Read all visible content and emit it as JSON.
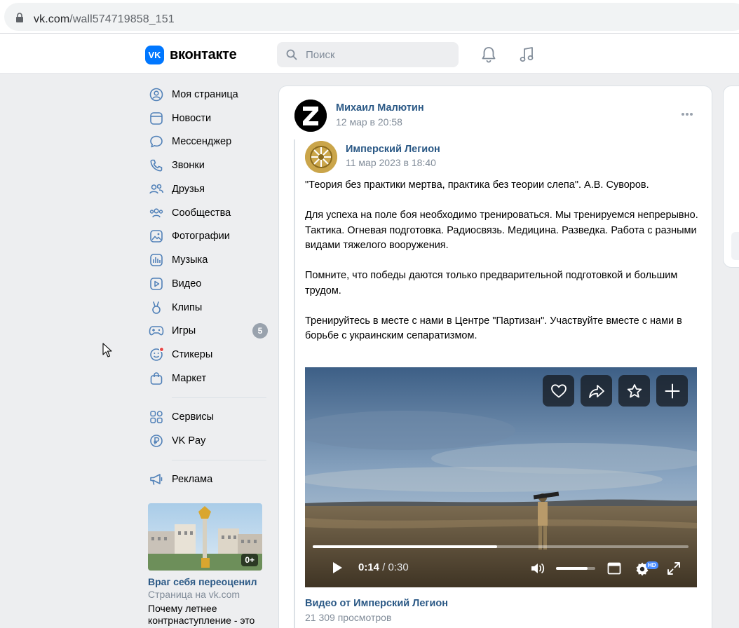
{
  "browser": {
    "url_host": "vk.com",
    "url_path": "/wall574719858_151"
  },
  "header": {
    "logo_text": "вконтакте",
    "logo_mark": "VK",
    "search_placeholder": "Поиск",
    "icons": [
      "bell-icon",
      "music-note-icon"
    ]
  },
  "sidebar": {
    "items": [
      {
        "label": "Моя страница",
        "icon": "user-circle-icon"
      },
      {
        "label": "Новости",
        "icon": "news-icon"
      },
      {
        "label": "Мессенджер",
        "icon": "message-icon"
      },
      {
        "label": "Звонки",
        "icon": "phone-icon"
      },
      {
        "label": "Друзья",
        "icon": "friends-icon"
      },
      {
        "label": "Сообщества",
        "icon": "communities-icon"
      },
      {
        "label": "Фотографии",
        "icon": "photo-icon"
      },
      {
        "label": "Музыка",
        "icon": "music-bars-icon"
      },
      {
        "label": "Видео",
        "icon": "video-icon"
      },
      {
        "label": "Клипы",
        "icon": "clips-icon"
      },
      {
        "label": "Игры",
        "icon": "gamepad-icon",
        "badge": "5"
      },
      {
        "label": "Стикеры",
        "icon": "sticker-icon"
      },
      {
        "label": "Маркет",
        "icon": "market-bag-icon"
      },
      {
        "label": "Сервисы",
        "icon": "services-grid-icon"
      },
      {
        "label": "VK Pay",
        "icon": "ruble-icon"
      },
      {
        "label": "Реклама",
        "icon": "megaphone-icon"
      }
    ],
    "promo": {
      "age": "0+",
      "title": "Враг себя переоценил",
      "subtitle": "Страница на vk.com",
      "text": "Почему летнее контрнаступление - это"
    }
  },
  "post": {
    "author": "Михаил Малютин",
    "date": "12 мар в 20:58",
    "avatar_letter": "Z",
    "repost": {
      "author": "Имперский Легион",
      "date": "11 мар 2023 в 18:40",
      "text": "\"Теория без практики мертва, практика без теории слепа\". А.В. Суворов.\n\nДля успеха на поле боя необходимо тренироваться. Мы тренируемся непрерывно.\nТактика. Огневая подготовка. Радиосвязь. Медицина. Разведка. Работа с разными видами тяжелого вооружения.\n\nПомните, что победы даются только предварительной подготовкой и большим трудом.\n\nТренируйтесь в месте с нами в Центре \"Партизан\". Участвуйте вместе с нами в борьбе с украинским сепаратизмом."
    },
    "video": {
      "current_time": "0:14",
      "separator": " / ",
      "duration": "0:30",
      "progress": 0.49,
      "volume": 0.8,
      "quality_badge": "HD",
      "title": "Видео от Имперский Легион",
      "views": "21 309 просмотров"
    }
  }
}
